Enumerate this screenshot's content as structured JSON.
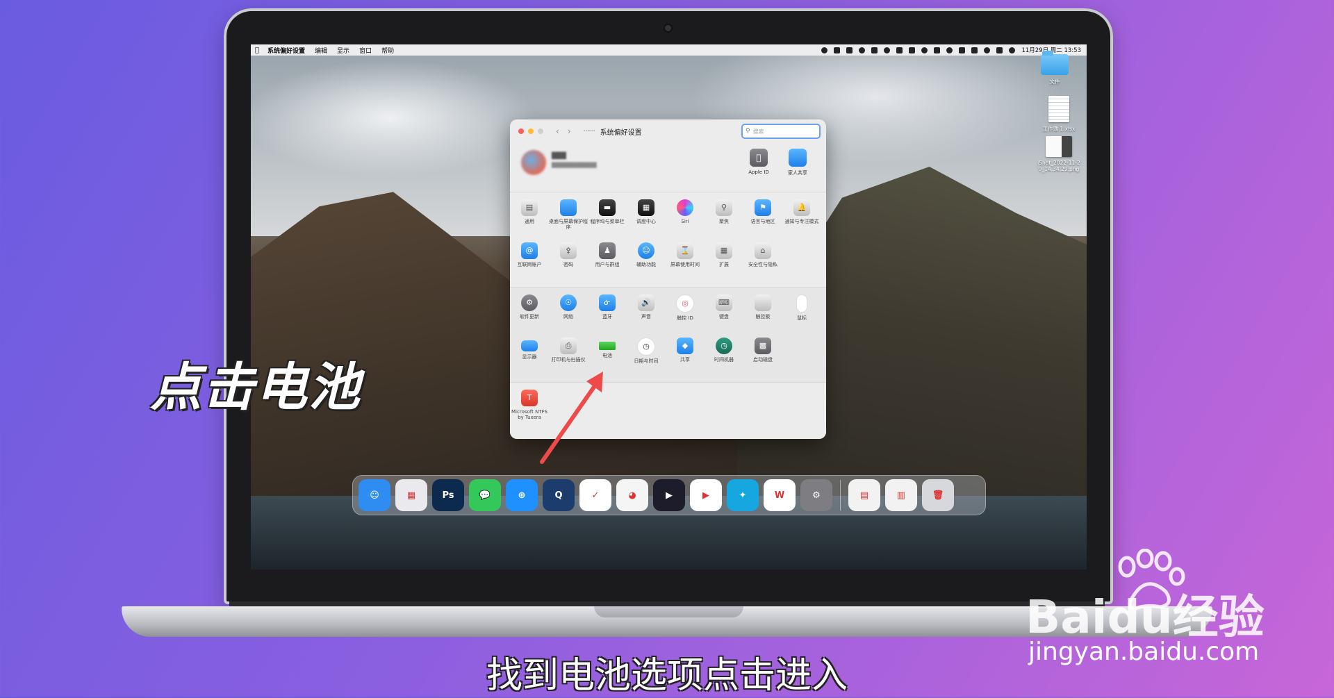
{
  "menubar": {
    "app_name": "系统偏好设置",
    "menus": [
      "编辑",
      "显示",
      "窗口",
      "帮助"
    ],
    "clock": "11月29日 周二 13:53"
  },
  "desktop": {
    "items": [
      {
        "label": "文件",
        "icon": "folder-icon"
      },
      {
        "label": "工作簿 1.xlsx",
        "icon": "spreadsheet-file-icon"
      },
      {
        "label": "iShot_2022-11-29_14.34.29.png",
        "icon": "image-file-icon"
      }
    ]
  },
  "window": {
    "title": "系统偏好设置",
    "search_placeholder": "搜索",
    "account": {
      "items": [
        {
          "label": "Apple ID",
          "icon": "apple-id-icon"
        },
        {
          "label": "家人共享",
          "icon": "family-sharing-icon"
        }
      ]
    },
    "sections": [
      {
        "rows": [
          [
            {
              "label": "通用",
              "icon": "general-icon"
            },
            {
              "label": "桌面与屏幕保护程序",
              "icon": "desktop-screensaver-icon"
            },
            {
              "label": "程序坞与菜单栏",
              "icon": "dock-menubar-icon"
            },
            {
              "label": "调度中心",
              "icon": "mission-control-icon"
            },
            {
              "label": "Siri",
              "icon": "siri-icon"
            },
            {
              "label": "聚焦",
              "icon": "spotlight-icon"
            },
            {
              "label": "语言与地区",
              "icon": "language-region-icon"
            },
            {
              "label": "通知与专注模式",
              "icon": "notifications-icon"
            }
          ],
          [
            {
              "label": "互联网帐户",
              "icon": "internet-accounts-icon"
            },
            {
              "label": "密码",
              "icon": "passwords-icon"
            },
            {
              "label": "用户与群组",
              "icon": "users-groups-icon"
            },
            {
              "label": "辅助功能",
              "icon": "accessibility-icon"
            },
            {
              "label": "屏幕使用时间",
              "icon": "screen-time-icon"
            },
            {
              "label": "扩展",
              "icon": "extensions-icon"
            },
            {
              "label": "安全性与隐私",
              "icon": "security-privacy-icon"
            }
          ]
        ]
      },
      {
        "rows": [
          [
            {
              "label": "软件更新",
              "icon": "software-update-icon"
            },
            {
              "label": "网络",
              "icon": "network-icon"
            },
            {
              "label": "蓝牙",
              "icon": "bluetooth-icon"
            },
            {
              "label": "声音",
              "icon": "sound-icon"
            },
            {
              "label": "触控 ID",
              "icon": "touch-id-icon"
            },
            {
              "label": "键盘",
              "icon": "keyboard-icon"
            },
            {
              "label": "触控板",
              "icon": "trackpad-icon"
            },
            {
              "label": "鼠标",
              "icon": "mouse-icon"
            }
          ],
          [
            {
              "label": "显示器",
              "icon": "displays-icon"
            },
            {
              "label": "打印机与扫描仪",
              "icon": "printers-scanners-icon"
            },
            {
              "label": "电池",
              "icon": "battery-icon"
            },
            {
              "label": "日期与时间",
              "icon": "date-time-icon"
            },
            {
              "label": "共享",
              "icon": "sharing-icon"
            },
            {
              "label": "时间机器",
              "icon": "time-machine-icon"
            },
            {
              "label": "启动磁盘",
              "icon": "startup-disk-icon"
            }
          ]
        ]
      },
      {
        "rows": [
          [
            {
              "label": "Microsoft NTFS by Tuxera",
              "icon": "tuxera-ntfs-icon"
            }
          ]
        ]
      }
    ]
  },
  "dock": {
    "items": [
      {
        "name": "finder-icon",
        "glyph": "☺",
        "color": "#2f8cf0"
      },
      {
        "name": "launchpad-icon",
        "glyph": "▦",
        "color": "#e9e9ee"
      },
      {
        "name": "photoshop-icon",
        "glyph": "Ps",
        "color": "#0c2a4d"
      },
      {
        "name": "messages-icon",
        "glyph": "💬",
        "color": "#34c759"
      },
      {
        "name": "safari-icon",
        "glyph": "⊕",
        "color": "#1e90ff"
      },
      {
        "name": "quicktime-icon",
        "glyph": "Q",
        "color": "#1c3c6e"
      },
      {
        "name": "lark-icon",
        "glyph": "✓",
        "color": "#ffffff"
      },
      {
        "name": "qq-icon",
        "glyph": "◕",
        "color": "#f5f5f5"
      },
      {
        "name": "video-player-icon",
        "glyph": "▶",
        "color": "#1c1c2a"
      },
      {
        "name": "youku-icon",
        "glyph": "▶",
        "color": "#ffffff"
      },
      {
        "name": "crab-app-icon",
        "glyph": "✦",
        "color": "#16a7e0"
      },
      {
        "name": "wps-icon",
        "glyph": "W",
        "color": "#ffffff"
      },
      {
        "name": "system-preferences-icon",
        "glyph": "⚙",
        "color": "#7d7d82"
      },
      {
        "name": "recent-window-icon",
        "glyph": "▤",
        "color": "#f2f2f2"
      },
      {
        "name": "recent-window-2-icon",
        "glyph": "▥",
        "color": "#f2f2f2"
      },
      {
        "name": "trash-icon",
        "glyph": "🗑",
        "color": "#d6d8dc"
      }
    ]
  },
  "overlay": {
    "instruction_label": "点击电池",
    "subtitle": "找到电池选项点击进入",
    "watermark_logo": "Baidu经验",
    "watermark_url": "jingyan.baidu.com"
  }
}
